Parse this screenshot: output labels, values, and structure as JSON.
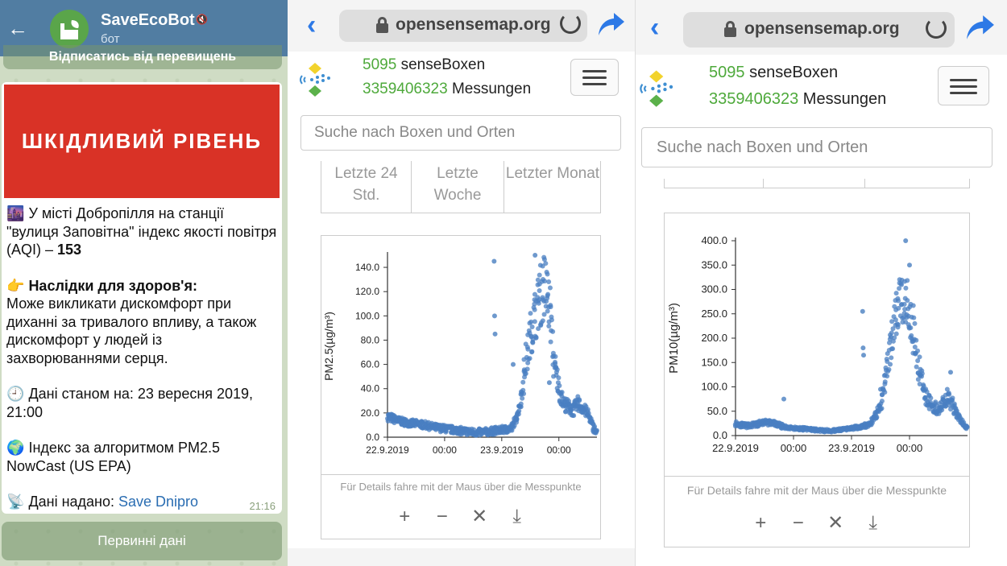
{
  "telegram": {
    "bot_name": "SaveEcoBot",
    "mute_glyph": "🔇",
    "subtitle": "бот",
    "unsubscribe_label": "Відписатись від перевищень",
    "banner": "ШКІДЛИВИЙ РІВЕНЬ",
    "line1_emoji": "🌆",
    "line1": "У місті Добропілля на станції \"вулиця Заповітна\" індекс якості повітря (AQI) – ",
    "aqi": "153",
    "health_emoji": "👉",
    "health_title": "Наслідки для здоров'я:",
    "health_text": "Може викликати дискомфорт при диханні за тривалого впливу, а також дискомфорт у людей із захворюваннями серця.",
    "date_emoji": "🕘",
    "date_text": "Дані станом на: 23 вересня 2019, 21:00",
    "index_emoji": "🌍",
    "index_text": "Індекс за алгоритмом PM2.5 NowCast (US EPA)",
    "source_emoji": "📡",
    "source_label": "Дані надано: ",
    "source_link": "Save Dnipro",
    "time": "21:16",
    "raw_button": "Первинні дані"
  },
  "browser_left": {
    "url": "opensensemap.org",
    "boxes_count": "5095",
    "boxes_label": "senseBoxen",
    "measurements_count": "3359406323",
    "measurements_label": "Messungen",
    "search_placeholder": "Suche nach Boxen und Orten",
    "tabs": [
      "Letzte 24 Std.",
      "Letzte Woche",
      "Letzter Monat"
    ],
    "hint": "Für Details fahre mit der Maus über die Messpunkte",
    "controls": [
      "+",
      "−",
      "✕",
      "⤓"
    ]
  },
  "browser_right": {
    "url": "opensensemap.org",
    "boxes_count": "5095",
    "boxes_label": "senseBoxen",
    "measurements_count": "3359406323",
    "measurements_label": "Messungen",
    "search_placeholder": "Suche nach Boxen und Orten",
    "hint": "Für Details fahre mit der Maus über die Messpunkte",
    "controls": [
      "+",
      "−",
      "✕",
      "⤓"
    ]
  },
  "colors": {
    "telegram_header": "#517da2",
    "banner_red": "#d93226",
    "link_blue": "#2a6db2",
    "ios_blue": "#2d79e6",
    "count_green": "#4ea93b",
    "point_blue": "#4a7fc1"
  },
  "chart_data": [
    {
      "type": "scatter",
      "title": "",
      "xlabel": "",
      "ylabel": "PM2.5(µg/m³)",
      "ylim": [
        0,
        150
      ],
      "yticks": [
        "0.0",
        "20.0",
        "40.0",
        "60.0",
        "80.0",
        "100.0",
        "120.0",
        "140.0"
      ],
      "xticks": [
        "22.9.2019",
        "00:00",
        "23.9.2019",
        "00:00"
      ],
      "xtick_hours": [
        0,
        12,
        24,
        36
      ],
      "xlim_hours": [
        0,
        44
      ],
      "grid": false,
      "series": [
        {
          "trend": [
            [
              0,
              17
            ],
            [
              2,
              14
            ],
            [
              4,
              12
            ],
            [
              6,
              11
            ],
            [
              8,
              10
            ],
            [
              10,
              8
            ],
            [
              12,
              7
            ],
            [
              14,
              6
            ],
            [
              16,
              5
            ],
            [
              18,
              4
            ],
            [
              20,
              4
            ],
            [
              22,
              5
            ],
            [
              24,
              6
            ],
            [
              26,
              7
            ],
            [
              27,
              15
            ],
            [
              28,
              30
            ],
            [
              29,
              60
            ],
            [
              30,
              85
            ],
            [
              31,
              100
            ],
            [
              32,
              115
            ],
            [
              33,
              125
            ],
            [
              34,
              110
            ],
            [
              35,
              60
            ],
            [
              36,
              40
            ],
            [
              37,
              28
            ],
            [
              38,
              25
            ],
            [
              39,
              22
            ],
            [
              40,
              28
            ],
            [
              41,
              24
            ],
            [
              42,
              20
            ],
            [
              43,
              10
            ],
            [
              44,
              3
            ]
          ],
          "outliers": [
            [
              22.4,
              145
            ],
            [
              22.5,
              100
            ],
            [
              22.6,
              85
            ],
            [
              26.4,
              60
            ],
            [
              31,
              150
            ],
            [
              34,
              45
            ]
          ]
        }
      ]
    },
    {
      "type": "scatter",
      "title": "",
      "xlabel": "",
      "ylabel": "PM10(µg/m³)",
      "ylim": [
        0,
        400
      ],
      "yticks": [
        "0.0",
        "50.0",
        "100.0",
        "150.0",
        "200.0",
        "250.0",
        "300.0",
        "350.0",
        "400.0"
      ],
      "xticks": [
        "22.9.2019",
        "00:00",
        "23.9.2019",
        "00:00"
      ],
      "xtick_hours": [
        0,
        12,
        24,
        36
      ],
      "xlim_hours": [
        0,
        48
      ],
      "grid": false,
      "series": [
        {
          "trend": [
            [
              0,
              25
            ],
            [
              2,
              20
            ],
            [
              4,
              22
            ],
            [
              6,
              28
            ],
            [
              8,
              25
            ],
            [
              10,
              18
            ],
            [
              12,
              15
            ],
            [
              14,
              14
            ],
            [
              16,
              12
            ],
            [
              18,
              10
            ],
            [
              20,
              10
            ],
            [
              22,
              12
            ],
            [
              24,
              15
            ],
            [
              26,
              18
            ],
            [
              28,
              25
            ],
            [
              30,
              60
            ],
            [
              31,
              120
            ],
            [
              32,
              180
            ],
            [
              33,
              230
            ],
            [
              34,
              280
            ],
            [
              35,
              300
            ],
            [
              36,
              260
            ],
            [
              37,
              200
            ],
            [
              38,
              140
            ],
            [
              39,
              90
            ],
            [
              40,
              70
            ],
            [
              41,
              60
            ],
            [
              42,
              55
            ],
            [
              43,
              65
            ],
            [
              44,
              80
            ],
            [
              45,
              60
            ],
            [
              46,
              40
            ],
            [
              47,
              25
            ],
            [
              48,
              15
            ]
          ],
          "outliers": [
            [
              10,
              75
            ],
            [
              26.3,
              255
            ],
            [
              26.4,
              180
            ],
            [
              26.5,
              165
            ],
            [
              30,
              95
            ],
            [
              35.2,
              400
            ],
            [
              36,
              350
            ],
            [
              44.5,
              130
            ]
          ]
        }
      ]
    }
  ]
}
